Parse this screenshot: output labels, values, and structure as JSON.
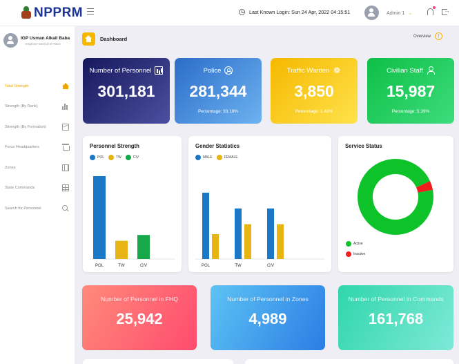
{
  "header": {
    "logo_text": "NPPRM",
    "login_info": "Last Known Login: Sun 24 Apr, 2022 04:15:51",
    "user_menu": "Admin 1"
  },
  "sidebar": {
    "profile_name": "IGP Usman Alkali Baba",
    "profile_role": "Inspector-General of Police",
    "items": [
      {
        "label": "Total Strength",
        "icon": "home-icon",
        "active": true
      },
      {
        "label": "Strength (By Rank)",
        "icon": "bar-chart-icon",
        "active": false
      },
      {
        "label": "Strength (By Formation)",
        "icon": "line-chart-icon",
        "active": false
      },
      {
        "label": "Force Headquarters",
        "icon": "bank-icon",
        "active": false
      },
      {
        "label": "Zones",
        "icon": "grid-icon",
        "active": false
      },
      {
        "label": "State Commands",
        "icon": "table-icon",
        "active": false
      },
      {
        "label": "Search for Personnel",
        "icon": "search-icon",
        "active": false
      }
    ]
  },
  "page": {
    "title": "Dashboard",
    "overview": "Overview"
  },
  "stats": [
    {
      "title": "Number of Personnel",
      "value": "301,181",
      "pct": "",
      "icon": "bar-chart-icon",
      "gradient": [
        "#16195c",
        "#4b4f9f"
      ]
    },
    {
      "title": "Police",
      "value": "281,344",
      "pct": "Percentage: 93.19%",
      "icon": "person-circle-icon",
      "gradient": [
        "#2c6dc8",
        "#6db2f0"
      ]
    },
    {
      "title": "Traffic Warden",
      "value": "3,850",
      "pct": "Percentage: 1.42%",
      "icon": "walking-person-icon",
      "gradient": [
        "#f5b800",
        "#ffe24a"
      ]
    },
    {
      "title": "Civilian Staff",
      "value": "15,987",
      "pct": "Percentage: 5.39%",
      "icon": "user-icon",
      "gradient": [
        "#0ebf45",
        "#3ddc7d"
      ]
    }
  ],
  "cards": {
    "personnel_strength": {
      "title": "Personnel Strength"
    },
    "gender_statistics": {
      "title": "Gender Statistics"
    },
    "service_status": {
      "title": "Service Status"
    }
  },
  "chart_data": [
    {
      "type": "bar",
      "title": "Personnel Strength",
      "categories": [
        "POL",
        "TW",
        "CIV"
      ],
      "series": [
        {
          "name": "POL",
          "color": "#1a78c6"
        },
        {
          "name": "TW",
          "color": "#e6b514"
        },
        {
          "name": "CIV",
          "color": "#16a94a"
        }
      ],
      "values": [
        281344,
        3850,
        15987
      ],
      "display_scale": [
        1.0,
        0.22,
        0.29
      ]
    },
    {
      "type": "bar",
      "title": "Gender Statistics",
      "categories": [
        "POL",
        "TW",
        "CIV"
      ],
      "series": [
        {
          "name": "MALE",
          "color": "#1a78c6",
          "rel_values": [
            0.8,
            0.61,
            0.61
          ]
        },
        {
          "name": "FEMALE",
          "color": "#e6b514",
          "rel_values": [
            0.3,
            0.42,
            0.42
          ]
        }
      ]
    },
    {
      "type": "pie",
      "title": "Service Status",
      "labels": [
        "Active",
        "Inactive"
      ],
      "values": [
        96,
        4
      ],
      "colors": [
        "#0ec22a",
        "#ef1d1d"
      ]
    }
  ],
  "totals": [
    {
      "title": "Number of Personnel in FHQ",
      "value": "25,942",
      "gradient": [
        "#ff8a7a",
        "#ff4b6e"
      ]
    },
    {
      "title": "Number of Personnel in Zones",
      "value": "4,989",
      "gradient": [
        "#5ec3f4",
        "#2b7de4"
      ]
    },
    {
      "title": "Number of Personnel in Commands",
      "value": "161,768",
      "gradient": [
        "#2fd6ac",
        "#7ee9d7"
      ]
    }
  ]
}
